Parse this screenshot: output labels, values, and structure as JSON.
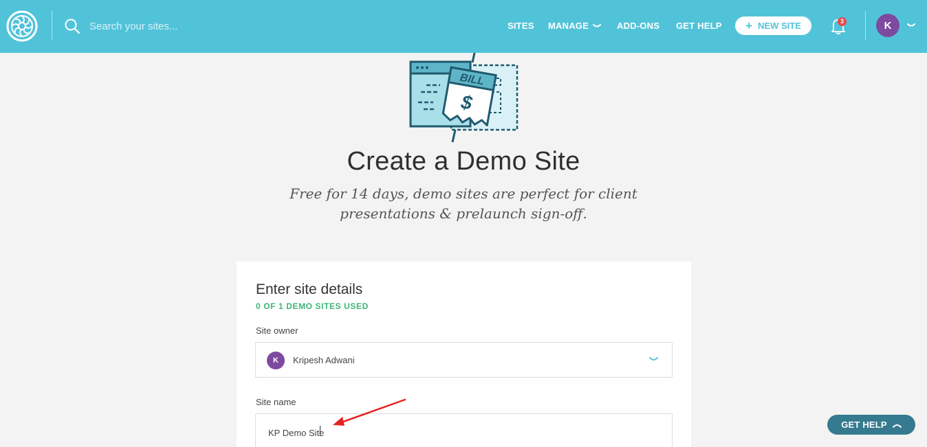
{
  "colors": {
    "topbar": "#51c3d9",
    "accent_green": "#3db577",
    "avatar_purple": "#7d4aa0",
    "help_button": "#357a8e",
    "badge_red": "#e9484d"
  },
  "topbar": {
    "logo_icon": "flywheel-logo-icon",
    "search": {
      "placeholder": "Search your sites...",
      "value": ""
    },
    "nav": [
      {
        "label": "SITES"
      },
      {
        "label": "MANAGE",
        "has_dropdown": true
      },
      {
        "label": "ADD-ONS"
      },
      {
        "label": "GET HELP"
      }
    ],
    "new_site_label": "NEW SITE",
    "notifications": {
      "count": "3"
    },
    "user_initial": "K"
  },
  "hero": {
    "illustration_text": {
      "bill": "BILL",
      "symbol": "$"
    },
    "title": "Create a Demo Site",
    "subtitle_line1": "Free for 14 days, demo sites are perfect for client",
    "subtitle_line2": "presentations & prelaunch sign-off."
  },
  "form": {
    "heading": "Enter site details",
    "usage": "0 OF 1 DEMO SITES USED",
    "owner": {
      "label": "Site owner",
      "initial": "K",
      "name": "Kripesh Adwani"
    },
    "site_name": {
      "label": "Site name",
      "value": "KP Demo Site"
    }
  },
  "help_button_label": "GET HELP"
}
